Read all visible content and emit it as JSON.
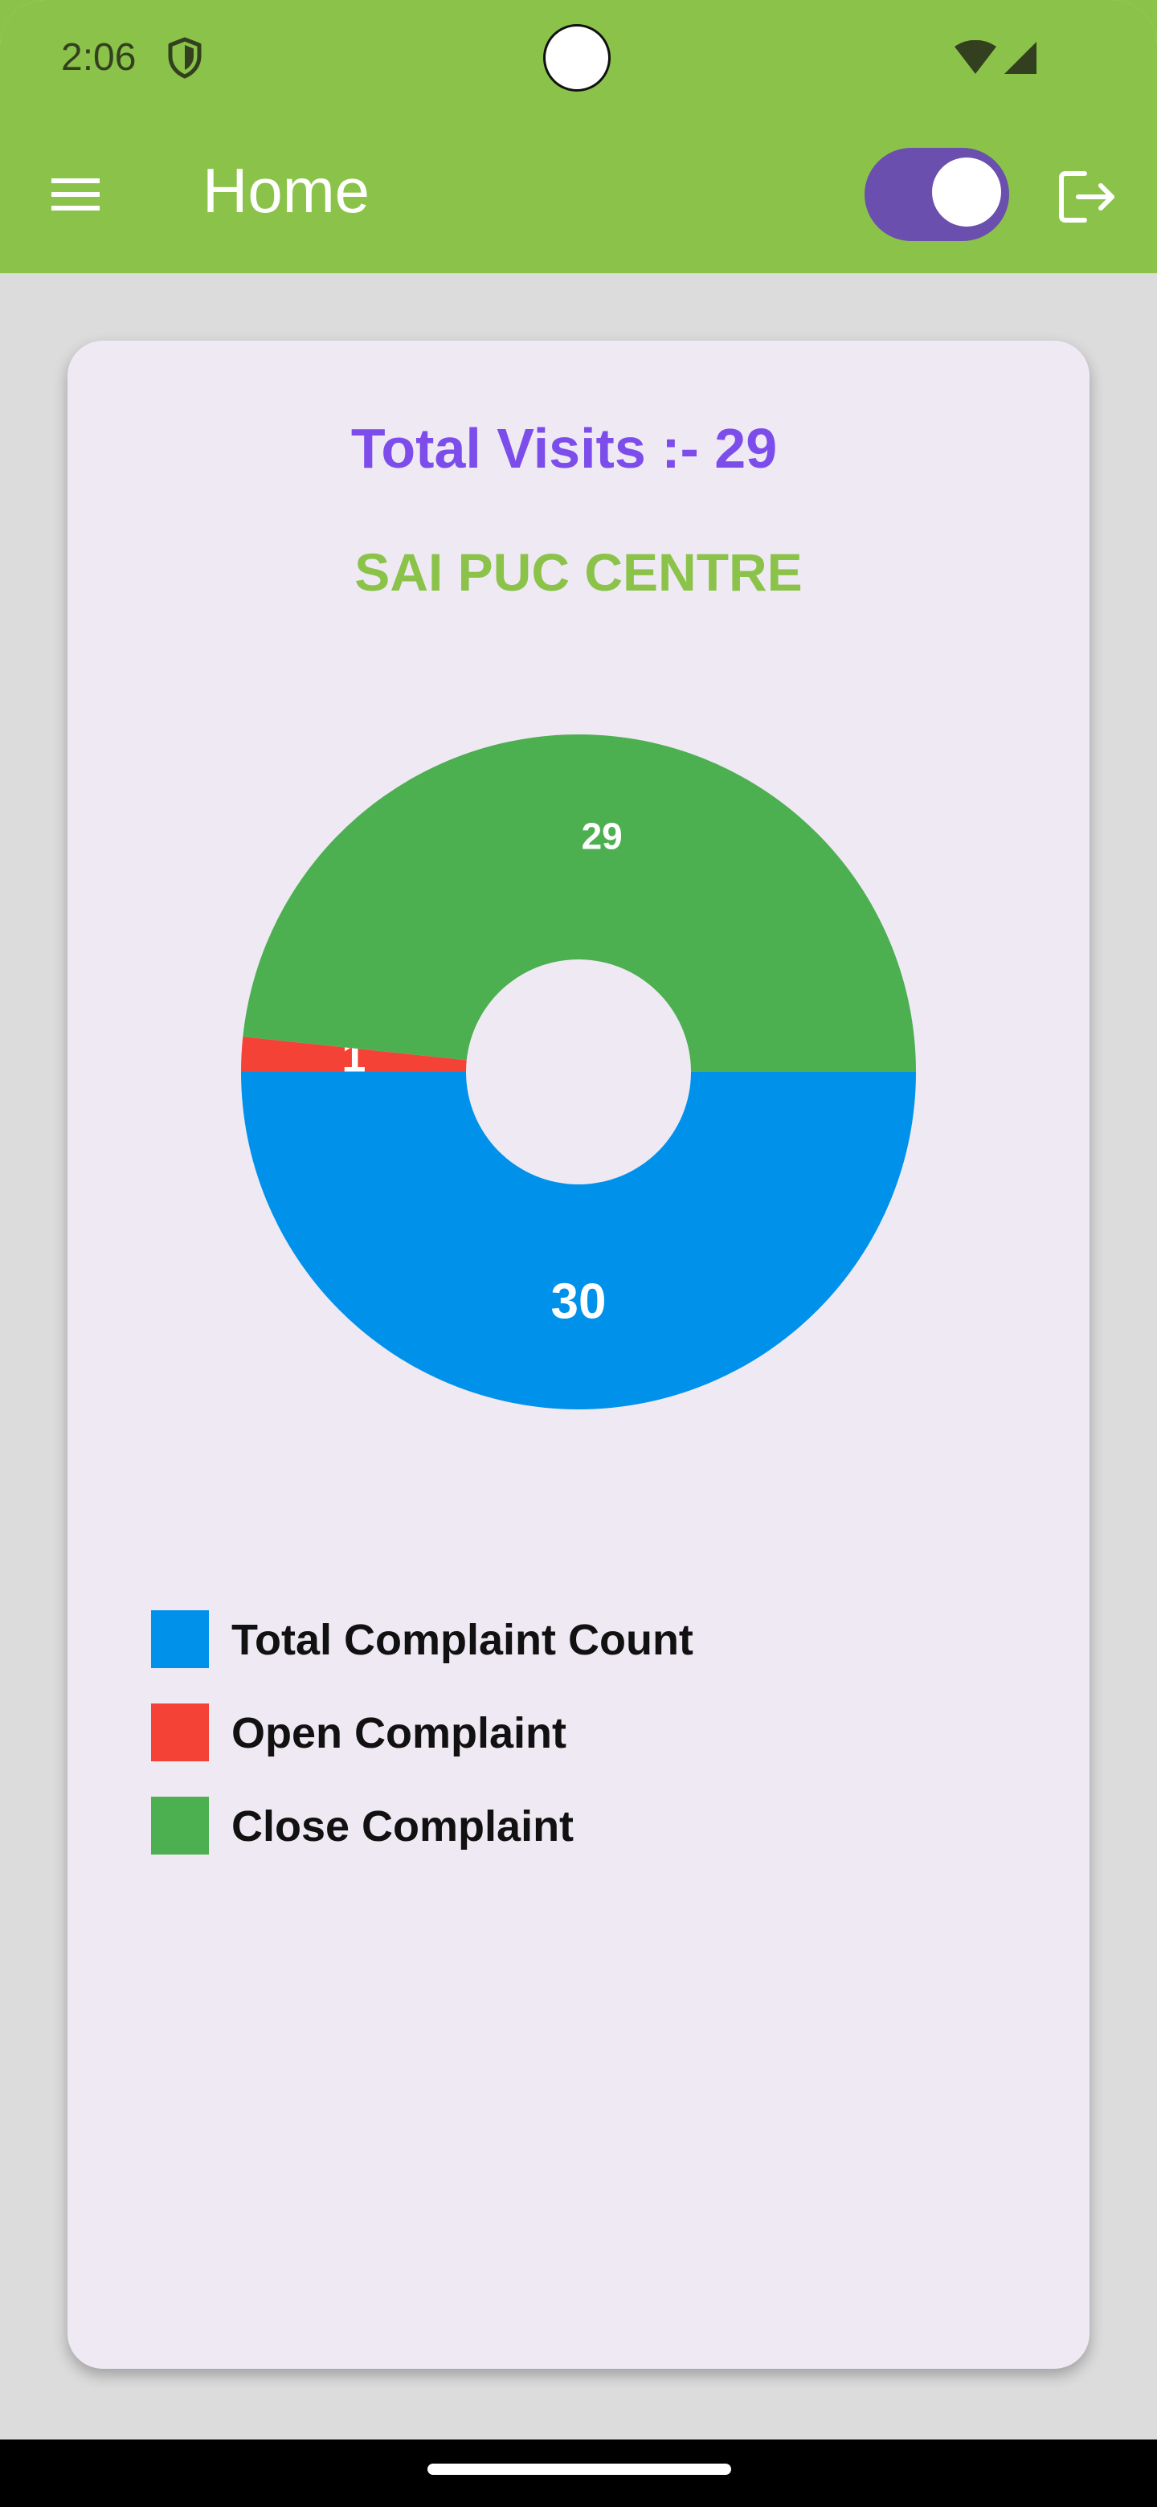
{
  "status_bar": {
    "time": "2:06",
    "icons": [
      "shield-icon",
      "wifi-icon",
      "signal-icon"
    ]
  },
  "toolbar": {
    "title": "Home",
    "menu_icon": "menu-icon",
    "toggle_state": "on",
    "logout_icon": "logout-icon",
    "color": "#8bc34a",
    "toggle_color": "#6a4fae"
  },
  "card": {
    "total_visits": "Total Visits :- 29",
    "centre_name": "SAI PUC CENTRE"
  },
  "chart_data": {
    "type": "pie",
    "style": "donut",
    "slices": [
      {
        "name": "Total Complaint Count",
        "value": 30,
        "label": "30",
        "color": "#0091ea"
      },
      {
        "name": "Open Complaint",
        "value": 1,
        "label": "1",
        "color": "#f44336"
      },
      {
        "name": "Close Complaint",
        "value": 29,
        "label": "29",
        "color": "#4caf50"
      }
    ],
    "legend_position": "bottom-left"
  },
  "legend": {
    "items": [
      {
        "label": "Total Complaint Count",
        "color": "#0091ea"
      },
      {
        "label": "Open Complaint",
        "color": "#f44336"
      },
      {
        "label": "Close Complaint",
        "color": "#4caf50"
      }
    ]
  }
}
